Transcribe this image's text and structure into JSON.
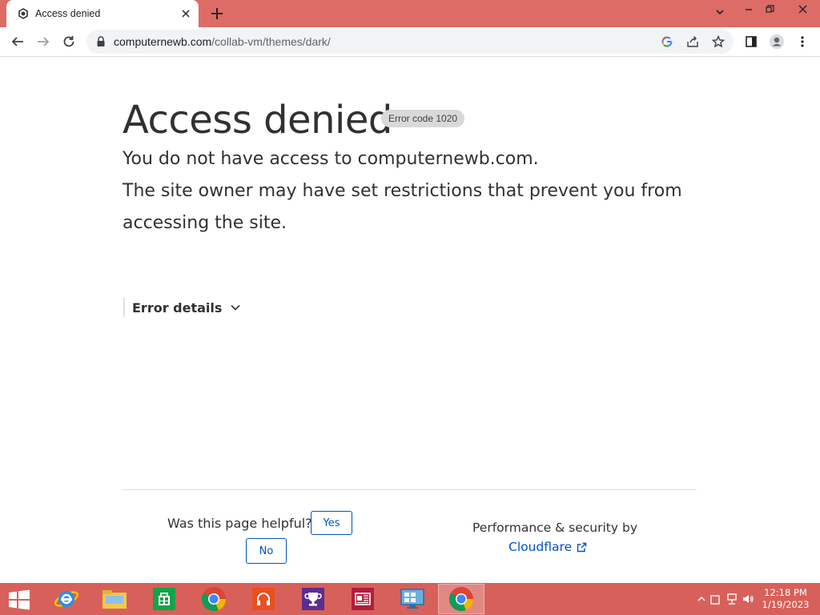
{
  "browser": {
    "tab": {
      "title": "Access denied"
    },
    "url": {
      "host": "computernewb.com",
      "path": "/collab-vm/themes/dark/"
    }
  },
  "page": {
    "title": "Access denied",
    "error_code": "Error code 1020",
    "line1": "You do not have access to computernewb.com.",
    "line2": "The site owner may have set restrictions that prevent you from",
    "line3": "accessing the site.",
    "details_label": "Error details"
  },
  "footer": {
    "helpful_question": "Was this page helpful?",
    "yes_label": "Yes",
    "no_label": "No",
    "perf_text": "Performance & security by",
    "cloudflare_label": "Cloudflare"
  },
  "taskbar": {
    "time": "12:18 PM",
    "date": "1/19/2023"
  },
  "colors": {
    "accent": "#dd6b66",
    "taskbar": "#d8605a",
    "link": "#0051c3"
  }
}
